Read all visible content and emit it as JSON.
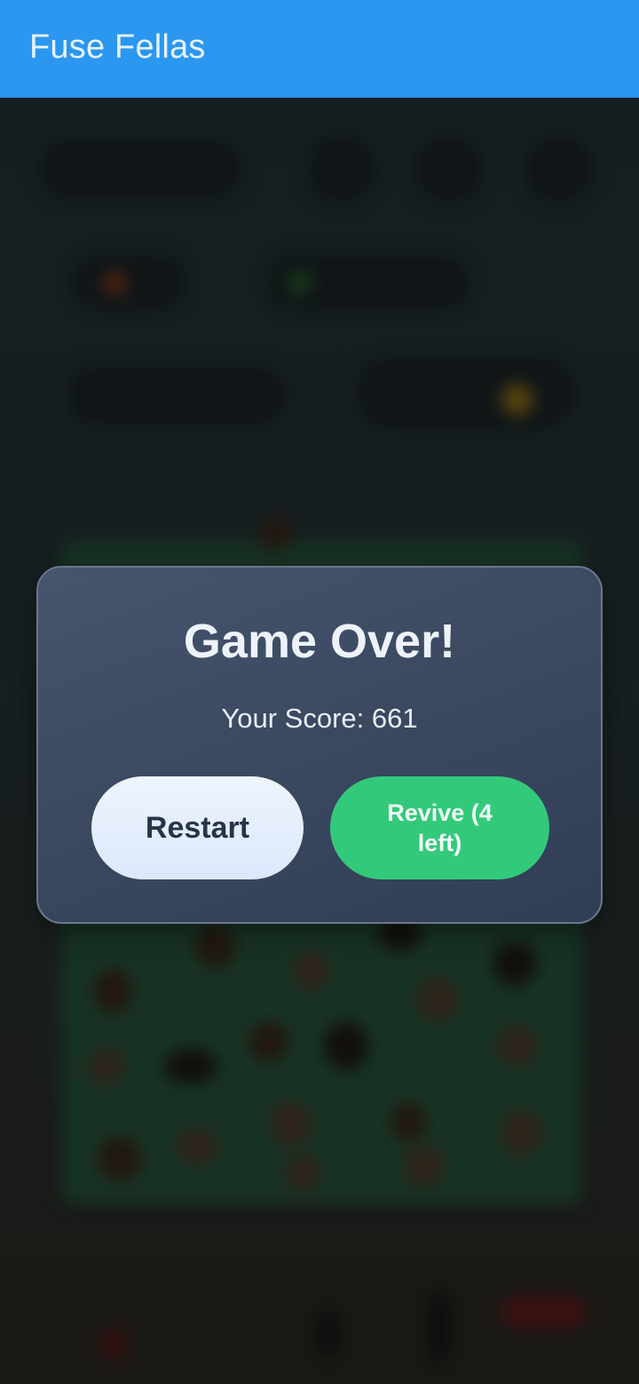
{
  "app_bar": {
    "title": "Fuse Fellas",
    "color": "#2b97f0"
  },
  "dialog": {
    "title": "Game Over!",
    "score_text": "Your Score: 661",
    "restart_label": "Restart",
    "revive_label": "Revive (4 left)"
  },
  "colors": {
    "accent": "#2b97f0",
    "revive": "#33c97b",
    "dialog_bg": "#3a4860"
  }
}
